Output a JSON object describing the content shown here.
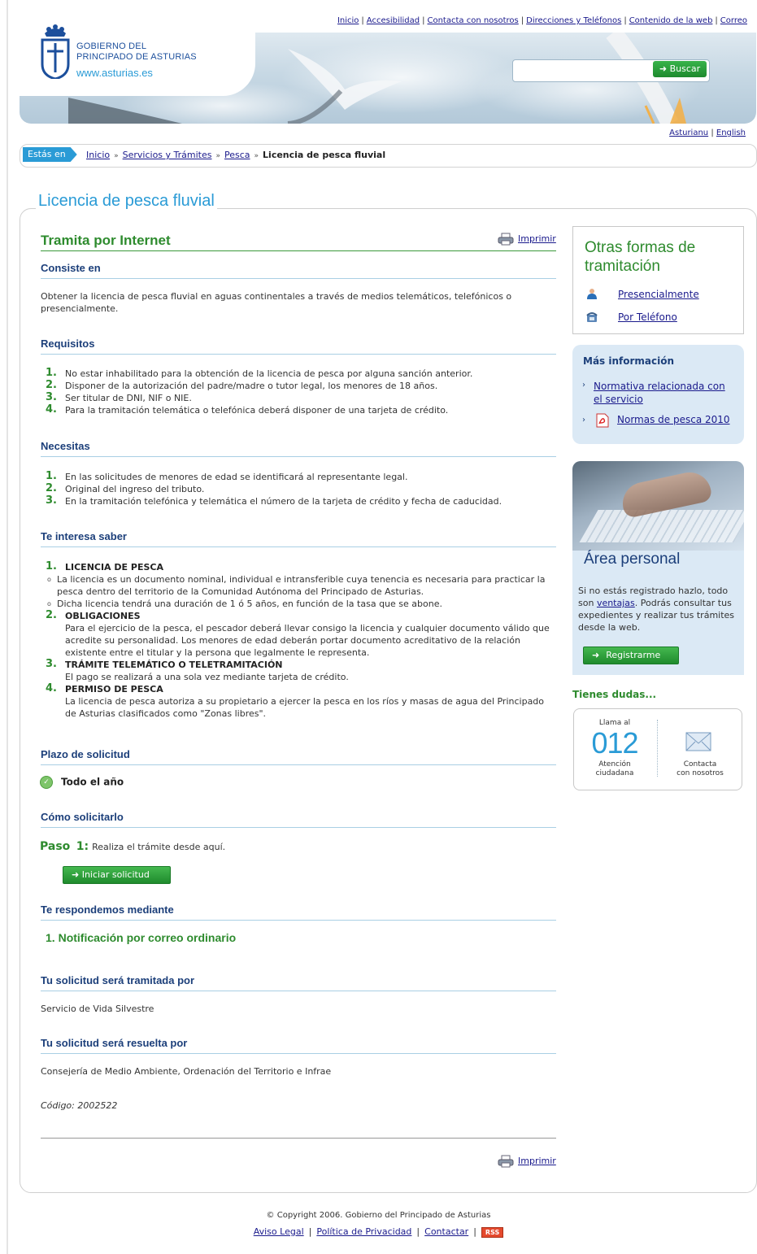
{
  "top_nav": [
    "Inicio",
    "Accesibilidad",
    "Contacta con nosotros",
    "Direcciones y Teléfonos",
    "Contenido de la web",
    "Correo"
  ],
  "logo": {
    "line1": "GOBIERNO DEL",
    "line2": "PRINCIPADO DE ASTURIAS",
    "url": "www.asturias.es"
  },
  "search": {
    "value": "",
    "button": "Buscar"
  },
  "languages": [
    "Asturianu",
    "English"
  ],
  "breadcrumb": {
    "label": "Estás en",
    "items": [
      "Inicio",
      "Servicios y Trámites",
      "Pesca"
    ],
    "current": "Licencia de pesca fluvial"
  },
  "page_title": "Licencia de pesca fluvial",
  "main": {
    "heading": "Tramita por Internet",
    "print_label": "Imprimir",
    "consiste": {
      "title": "Consiste en",
      "text": "Obtener la licencia de pesca fluvial en aguas continentales a través de medios telemáticos, telefónicos o presencialmente."
    },
    "requisitos": {
      "title": "Requisitos",
      "items": [
        "No estar inhabilitado para la obtención de la licencia de pesca por alguna sanción anterior.",
        "Disponer de la autorización del padre/madre o tutor legal, los menores de 18 años.",
        "Ser titular de DNI, NIF o NIE.",
        "Para la tramitación telemática o telefónica deberá disponer de una tarjeta de crédito."
      ]
    },
    "necesitas": {
      "title": "Necesitas",
      "items": [
        "En las solicitudes de menores de edad se identificará al representante legal.",
        "Original del ingreso del tributo.",
        "En la tramitación telefónica y telemática el número de la tarjeta de crédito y fecha de caducidad."
      ]
    },
    "interesa": {
      "title": "Te interesa saber",
      "items": [
        {
          "title": "LICENCIA DE PESCA",
          "sub": [
            "La licencia es un documento nominal, individual e intransferible cuya tenencia es necesaria para practicar la pesca dentro del territorio de la Comunidad Autónoma del Principado de Asturias.",
            "Dicha licencia tendrá una duración de 1 ó 5 años, en función de la tasa que se abone."
          ]
        },
        {
          "title": "OBLIGACIONES",
          "text": "Para el ejercicio de la pesca, el pescador deberá llevar consigo la licencia y cualquier documento válido que acredite su personalidad. Los menores de edad deberán portar documento acreditativo de la relación existente entre el titular y la persona que legalmente le representa."
        },
        {
          "title": "TRÁMITE TELEMÁTICO O TELETRAMITACIÓN",
          "text": "El pago se realizará a una sola vez mediante tarjeta de crédito."
        },
        {
          "title": "PERMISO DE PESCA",
          "text": "La licencia de pesca autoriza a su propietario a ejercer la pesca en los ríos y masas de agua del Principado de Asturias clasificados como \"Zonas libres\"."
        }
      ]
    },
    "plazo": {
      "title": "Plazo de solicitud",
      "value": "Todo el año"
    },
    "como": {
      "title": "Cómo solicitarlo",
      "paso_label": "Paso",
      "paso_num": "1:",
      "paso_text": "Realiza el trámite desde aquí.",
      "button": "Iniciar solicitud"
    },
    "respondemos": {
      "title": "Te respondemos mediante",
      "num": "1.",
      "item": "Notificación por correo ordinario"
    },
    "tramitada": {
      "title": "Tu solicitud será tramitada por",
      "value": "Servicio de Vida Silvestre"
    },
    "resuelta": {
      "title": "Tu solicitud será resuelta por",
      "value": "Consejería de Medio Ambiente, Ordenación del Territorio e Infrae"
    },
    "codigo": {
      "label": "Código:",
      "value": "2002522"
    }
  },
  "sidebar": {
    "otras": {
      "title": "Otras formas de tramitación",
      "links": [
        "Presencialmente",
        "Por Teléfono"
      ]
    },
    "mas_info": {
      "title": "Más información",
      "links": [
        "Normativa relacionada con el servicio",
        "Normas de pesca 2010"
      ]
    },
    "area": {
      "title": "Área personal",
      "text_before": "Si no estás registrado hazlo, todo son ",
      "link": "ventajas",
      "text_after": ". Podrás consultar tus expedientes y realizar tus trámites desde la web.",
      "button": "Registrarme"
    },
    "dudas": {
      "title": "Tienes dudas...",
      "llama": "Llama al",
      "number": "012",
      "atencion_1": "Atención",
      "atencion_2": "ciudadana",
      "contacta_1": "Contacta",
      "contacta_2": "con nosotros"
    }
  },
  "footer": {
    "copyright": "© Copyright 2006. Gobierno del Principado de Asturias",
    "links": [
      "Aviso Legal",
      "Política de Privacidad",
      "Contactar"
    ],
    "rss": "RSS"
  },
  "colors": {
    "accent_blue": "#2a9bd6",
    "green": "#2e8b2e",
    "navy": "#1c3f7a"
  }
}
